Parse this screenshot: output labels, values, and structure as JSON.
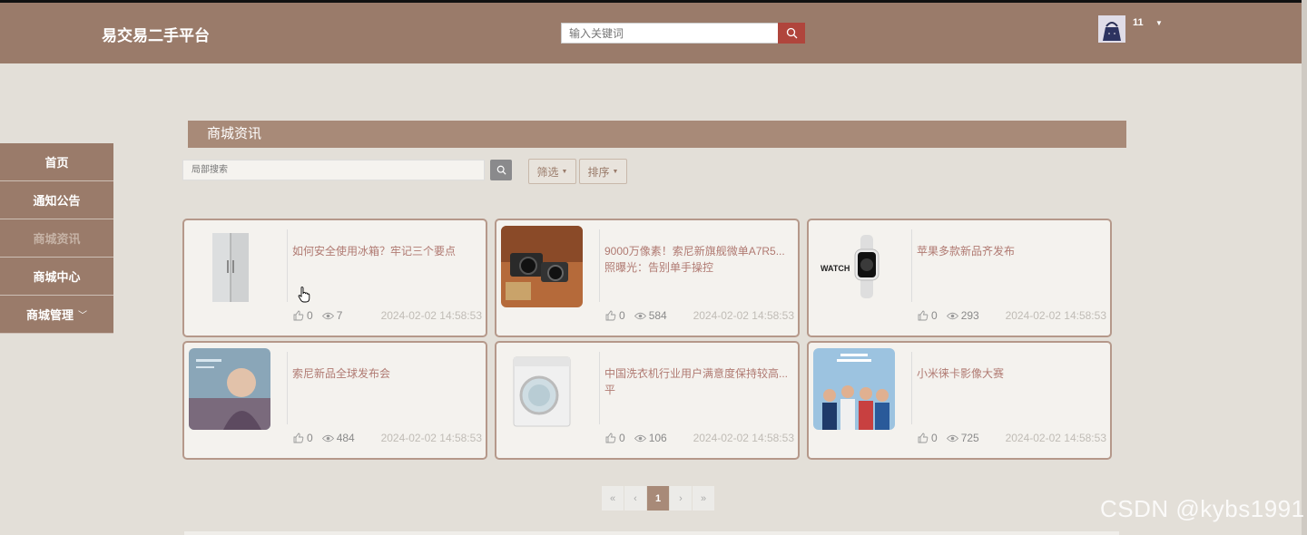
{
  "header": {
    "brand": "易交易二手平台",
    "search_placeholder": "输入关键词",
    "username": "11"
  },
  "sidebar": {
    "items": [
      {
        "label": "首页"
      },
      {
        "label": "通知公告"
      },
      {
        "label": "商城资讯"
      },
      {
        "label": "商城中心"
      },
      {
        "label": "商城管理"
      }
    ]
  },
  "main": {
    "section_title": "商城资讯",
    "local_search_placeholder": "局部搜索",
    "filter_label": "筛选",
    "sort_label": "排序"
  },
  "cards": [
    {
      "title": "如何安全使用冰箱？牢记三个要点",
      "likes": "0",
      "views": "7",
      "date": "2024-02-02 14:58:53"
    },
    {
      "title": "9000万像素！索尼新旗舰微单A7R5...照曝光：告别单手操控",
      "likes": "0",
      "views": "584",
      "date": "2024-02-02 14:58:53"
    },
    {
      "title": "苹果多款新品齐发布",
      "likes": "0",
      "views": "293",
      "date": "2024-02-02 14:58:53"
    },
    {
      "title": "索尼新品全球发布会",
      "likes": "0",
      "views": "484",
      "date": "2024-02-02 14:58:53"
    },
    {
      "title": "中国洗衣机行业用户满意度保持较高...平",
      "likes": "0",
      "views": "106",
      "date": "2024-02-02 14:58:53"
    },
    {
      "title": "小米徕卡影像大赛",
      "likes": "0",
      "views": "725",
      "date": "2024-02-02 14:58:53"
    }
  ],
  "pagination": {
    "first": "«",
    "prev": "‹",
    "current": "1",
    "next": "›",
    "last": "»"
  },
  "watermark": "CSDN @kybs1991",
  "colors": {
    "header_bg": "#9a7b6a",
    "accent": "#a88a78",
    "search_button": "#b0453c",
    "title_text": "#b07a72"
  }
}
